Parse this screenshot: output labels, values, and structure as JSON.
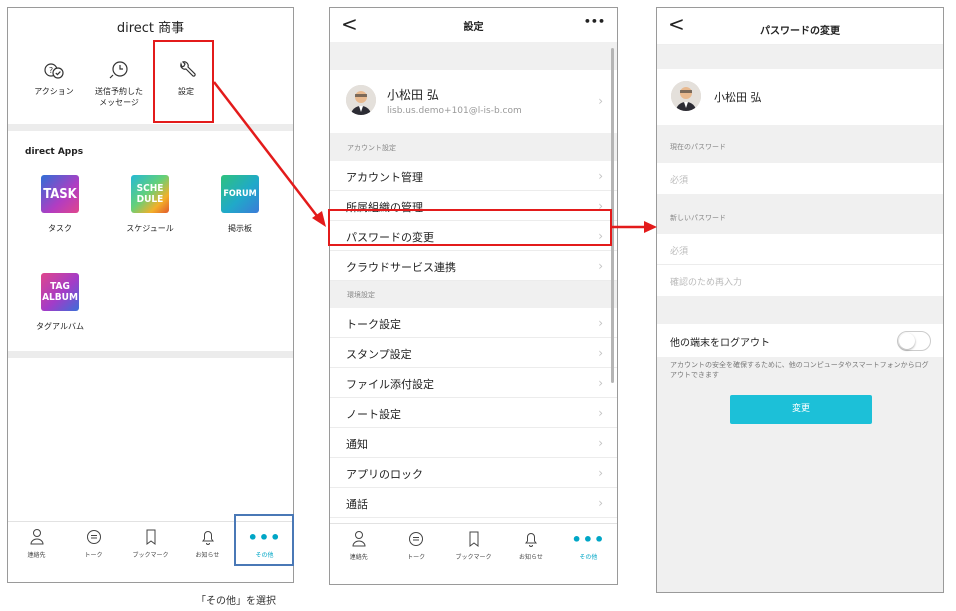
{
  "screen1": {
    "title": "direct 商事",
    "actions": [
      {
        "label": "アクション",
        "icon": "actions-icon"
      },
      {
        "label": "送信予約した\nメッセージ",
        "icon": "scheduled-messages-icon"
      },
      {
        "label": "設定",
        "icon": "wrench-icon"
      }
    ],
    "apps_title": "direct Apps",
    "apps": [
      {
        "tile": "TASK",
        "label": "タスク",
        "icon": "task-app-icon"
      },
      {
        "tile": "SCHE\nDULE",
        "label": "スケジュール",
        "icon": "schedule-app-icon"
      },
      {
        "tile": "FORUM",
        "label": "掲示板",
        "icon": "forum-app-icon"
      },
      {
        "tile": "TAG\nALBUM",
        "label": "タグアルバム",
        "icon": "tag-album-app-icon"
      }
    ],
    "tabs": [
      {
        "label": "連絡先",
        "icon": "person-icon"
      },
      {
        "label": "トーク",
        "icon": "chat-bubble-icon"
      },
      {
        "label": "ブックマーク",
        "icon": "bookmark-icon"
      },
      {
        "label": "お知らせ",
        "icon": "bell-icon"
      },
      {
        "label": "その他",
        "icon": "more-dots-icon"
      }
    ],
    "more_glyph": "•••"
  },
  "screen2": {
    "back": "<",
    "title": "設定",
    "more": "•••",
    "profile": {
      "name": "小松田 弘",
      "email": "lisb.us.demo+101@l-is-b.com"
    },
    "account_section": "アカウント設定",
    "account_rows": [
      "アカウント管理",
      "所属組織の管理",
      "パスワードの変更",
      "クラウドサービス連携"
    ],
    "env_section": "環境設定",
    "env_rows": [
      "トーク設定",
      "スタンプ設定",
      "ファイル添付設定",
      "ノート設定",
      "通知",
      "アプリのロック",
      "通話"
    ],
    "chevron": "›"
  },
  "screen3": {
    "back": "<",
    "title": "パスワードの変更",
    "profile_name": "小松田 弘",
    "current_label": "現在のパスワード",
    "current_placeholder": "必須",
    "new_label": "新しいパスワード",
    "new_placeholder": "必須",
    "confirm_placeholder": "確認のため再入力",
    "logout_label": "他の端末をログアウト",
    "logout_desc": "アカウントの安全を確保するために、他のコンピュータやスマートフォンからログアウトできます",
    "logout_enabled": false,
    "submit": "変更"
  },
  "caption": "「その他」を選択",
  "colors": {
    "highlight": "#e31b1b",
    "tab_highlight": "#4a78b6",
    "accent": "#00a6c6",
    "button": "#1cc0d8"
  }
}
